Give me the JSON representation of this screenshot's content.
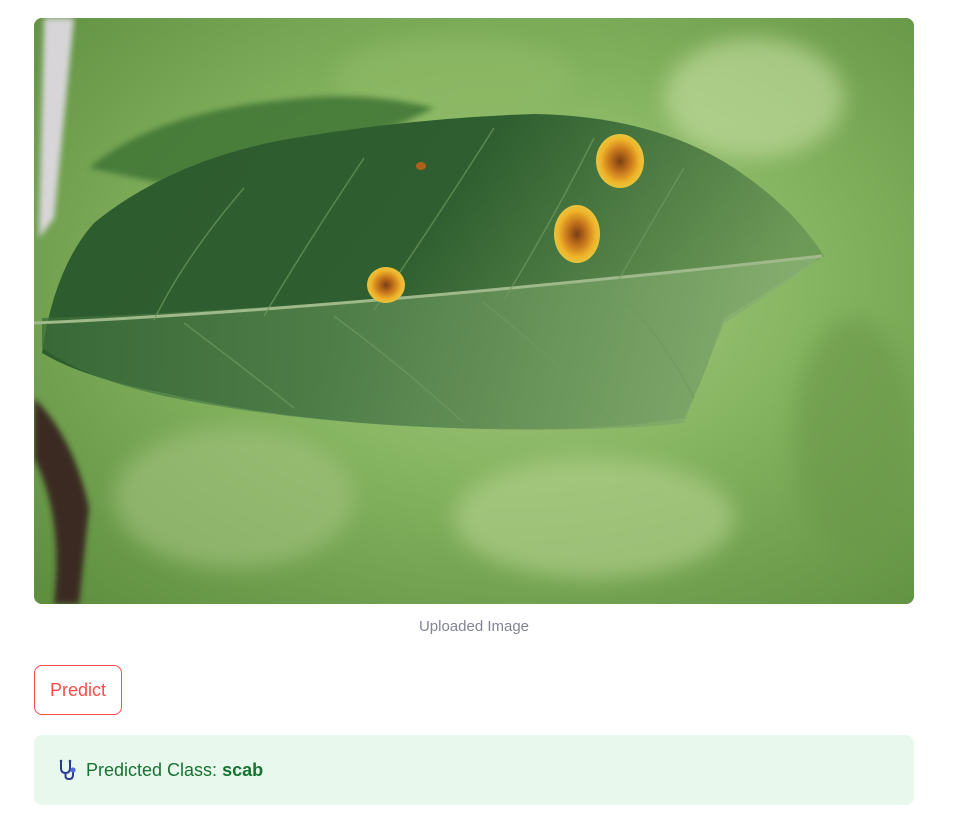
{
  "image": {
    "caption": "Uploaded Image",
    "subject": "leaf-photo"
  },
  "predict_button": {
    "label": "Predict"
  },
  "result": {
    "icon": "stethoscope-icon",
    "label": "Predicted Class:",
    "value": "scab"
  },
  "colors": {
    "accent": "#ff4b4b",
    "success_bg": "#e9f8ec",
    "success_text": "#177233",
    "caption": "#808495"
  }
}
